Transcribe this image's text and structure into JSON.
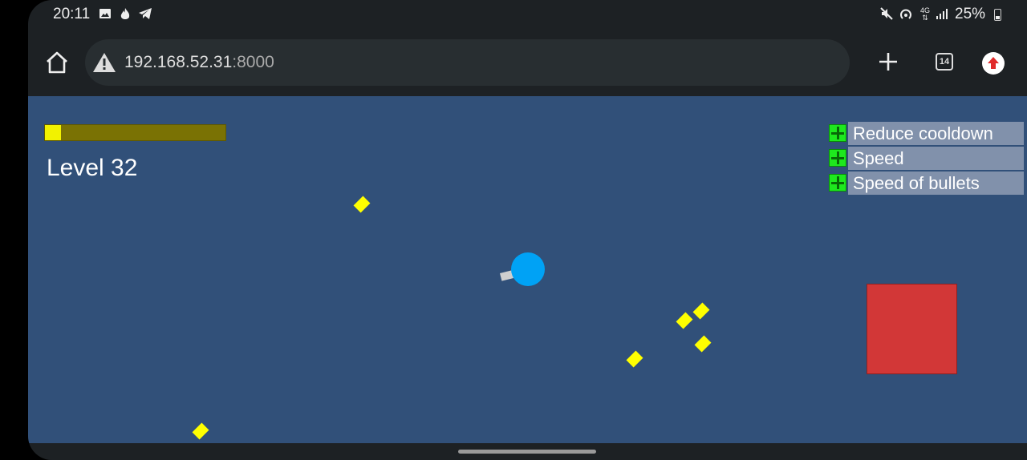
{
  "status_bar": {
    "time": "20:11",
    "battery_percent": "25%",
    "left_icons": [
      "image-icon",
      "flame-icon",
      "telegram-icon"
    ],
    "right_icons": [
      "mute-icon",
      "hotspot-icon",
      "4g-icon",
      "signal-icon",
      "battery-icon"
    ]
  },
  "browser": {
    "url_host": "192.168.52.31",
    "url_port": ":8000",
    "security_icon": "warning-icon",
    "tab_count": "14",
    "icons": [
      "home-icon",
      "plus-icon",
      "tabs-icon",
      "update-icon"
    ]
  },
  "game": {
    "level_text": "Level 32",
    "xp_progress": 0.09,
    "colors": {
      "background": "#315079",
      "player": "#00a2f5",
      "enemy": "#d23737",
      "gem": "#ffff00",
      "xp_fill": "#f2f200",
      "xp_track": "#7a7204",
      "upgrade_button": "#1ee81e"
    },
    "upgrades": [
      {
        "label": "Reduce cooldown"
      },
      {
        "label": "Speed"
      },
      {
        "label": "Speed of bullets"
      }
    ]
  }
}
